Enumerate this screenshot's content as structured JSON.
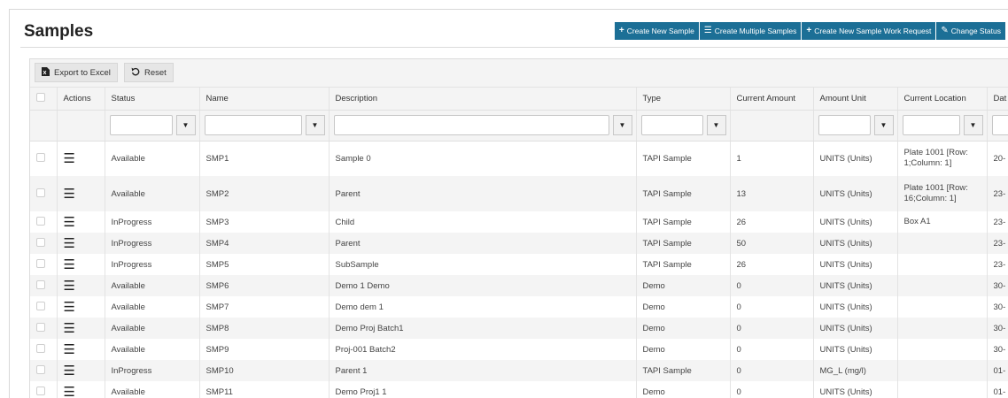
{
  "page": {
    "title": "Samples"
  },
  "top_actions": [
    {
      "icon": "+",
      "label": "Create New Sample"
    },
    {
      "icon": "☰",
      "label": "Create Multiple Samples"
    },
    {
      "icon": "+",
      "label": "Create New Sample Work Request"
    },
    {
      "icon": "✎",
      "label": "Change Status"
    }
  ],
  "toolbar": {
    "export_label": "Export to Excel",
    "reset_label": "Reset"
  },
  "columns": {
    "actions": "Actions",
    "status": "Status",
    "name": "Name",
    "description": "Description",
    "type": "Type",
    "current_amount": "Current Amount",
    "amount_unit": "Amount Unit",
    "current_location": "Current Location",
    "date": "Dat"
  },
  "rows": [
    {
      "status": "Available",
      "name": "SMP1",
      "description": "Sample 0",
      "type": "TAPI Sample",
      "amount": "1",
      "unit": "UNITS (Units)",
      "location": "Plate 1001 [Row: 1;Column: 1]",
      "date": "20-"
    },
    {
      "status": "Available",
      "name": "SMP2",
      "description": "Parent",
      "type": "TAPI Sample",
      "amount": "13",
      "unit": "UNITS (Units)",
      "location": "Plate 1001 [Row: 16;Column: 1]",
      "date": "23-"
    },
    {
      "status": "InProgress",
      "name": "SMP3",
      "description": "Child",
      "type": "TAPI Sample",
      "amount": "26",
      "unit": "UNITS (Units)",
      "location": "Box A1",
      "date": "23-"
    },
    {
      "status": "InProgress",
      "name": "SMP4",
      "description": "Parent",
      "type": "TAPI Sample",
      "amount": "50",
      "unit": "UNITS (Units)",
      "location": "",
      "date": "23-"
    },
    {
      "status": "InProgress",
      "name": "SMP5",
      "description": "SubSample",
      "type": "TAPI Sample",
      "amount": "26",
      "unit": "UNITS (Units)",
      "location": "",
      "date": "23-"
    },
    {
      "status": "Available",
      "name": "SMP6",
      "description": "Demo 1 Demo",
      "type": "Demo",
      "amount": "0",
      "unit": "UNITS (Units)",
      "location": "",
      "date": "30-"
    },
    {
      "status": "Available",
      "name": "SMP7",
      "description": "Demo dem 1",
      "type": "Demo",
      "amount": "0",
      "unit": "UNITS (Units)",
      "location": "",
      "date": "30-"
    },
    {
      "status": "Available",
      "name": "SMP8",
      "description": "Demo Proj Batch1",
      "type": "Demo",
      "amount": "0",
      "unit": "UNITS (Units)",
      "location": "",
      "date": "30-"
    },
    {
      "status": "Available",
      "name": "SMP9",
      "description": "Proj-001 Batch2",
      "type": "Demo",
      "amount": "0",
      "unit": "UNITS (Units)",
      "location": "",
      "date": "30-"
    },
    {
      "status": "InProgress",
      "name": "SMP10",
      "description": "Parent 1",
      "type": "TAPI Sample",
      "amount": "0",
      "unit": "MG_L (mg/l)",
      "location": "",
      "date": "01-"
    },
    {
      "status": "Available",
      "name": "SMP11",
      "description": "Demo Proj1 1",
      "type": "Demo",
      "amount": "0",
      "unit": "UNITS (Units)",
      "location": "",
      "date": "01-"
    }
  ]
}
